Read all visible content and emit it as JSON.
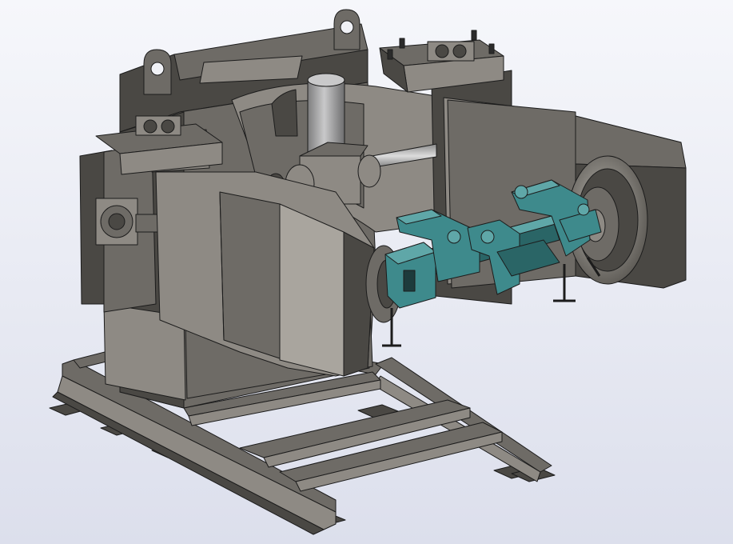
{
  "scene": {
    "subject": "cad-model",
    "colors": {
      "background_top": "#f6f7fb",
      "background_bottom": "#dcdfec",
      "frame_dark": "#4a4844",
      "frame_mid": "#6e6b66",
      "frame_light": "#8e8a84",
      "frame_highlight": "#a9a59e",
      "edge_line": "#1c1c1c",
      "fixture_teal": "#3e8a8c",
      "fixture_teal_light": "#5fa7a8",
      "fixture_teal_dark": "#2a6566",
      "motor_gray": "#9b9b9c",
      "motor_light": "#c7c7c8"
    }
  }
}
